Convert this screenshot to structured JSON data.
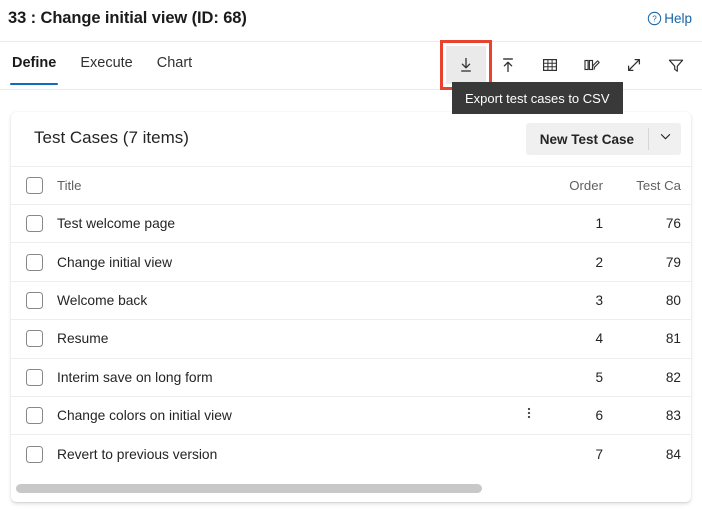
{
  "header": {
    "title": "33 : Change initial view (ID: 68)",
    "help_label": "Help",
    "help_icon": "question-circle-icon"
  },
  "tabs": [
    {
      "label": "Define",
      "active": true
    },
    {
      "label": "Execute",
      "active": false
    },
    {
      "label": "Chart",
      "active": false
    }
  ],
  "toolbar": {
    "buttons": [
      {
        "name": "export-csv-button",
        "icon": "download-icon",
        "highlighted": true,
        "hovered": true
      },
      {
        "name": "import-csv-button",
        "icon": "upload-icon",
        "highlighted": false,
        "hovered": false
      },
      {
        "name": "grid-view-button",
        "icon": "grid-icon",
        "highlighted": false,
        "hovered": false
      },
      {
        "name": "edit-columns-button",
        "icon": "columns-edit-icon",
        "highlighted": false,
        "hovered": false
      },
      {
        "name": "expand-button",
        "icon": "expand-diagonal-icon",
        "highlighted": false,
        "hovered": false
      },
      {
        "name": "filter-button",
        "icon": "funnel-icon",
        "highlighted": false,
        "hovered": false
      }
    ],
    "tooltip": "Export test cases to CSV"
  },
  "card": {
    "title": "Test Cases (7 items)",
    "new_button_label": "New Test Case",
    "new_button_chevron": "chevron-down-icon"
  },
  "table": {
    "columns": {
      "title": "Title",
      "order": "Order",
      "test_case_id": "Test Ca"
    },
    "rows": [
      {
        "title": "Test welcome page",
        "order": "1",
        "test_case_id": "76",
        "more": false
      },
      {
        "title": "Change initial view",
        "order": "2",
        "test_case_id": "79",
        "more": false
      },
      {
        "title": "Welcome back",
        "order": "3",
        "test_case_id": "80",
        "more": false
      },
      {
        "title": "Resume",
        "order": "4",
        "test_case_id": "81",
        "more": false
      },
      {
        "title": "Interim save on long form",
        "order": "5",
        "test_case_id": "82",
        "more": false
      },
      {
        "title": "Change colors on initial view",
        "order": "6",
        "test_case_id": "83",
        "more": true
      },
      {
        "title": "Revert to previous version",
        "order": "7",
        "test_case_id": "84",
        "more": false
      }
    ]
  },
  "colors": {
    "accent": "#0f6cbd",
    "link": "#1664a8",
    "highlight_box": "#e8432e",
    "tooltip_bg": "#393939",
    "header_text": "#616161"
  }
}
